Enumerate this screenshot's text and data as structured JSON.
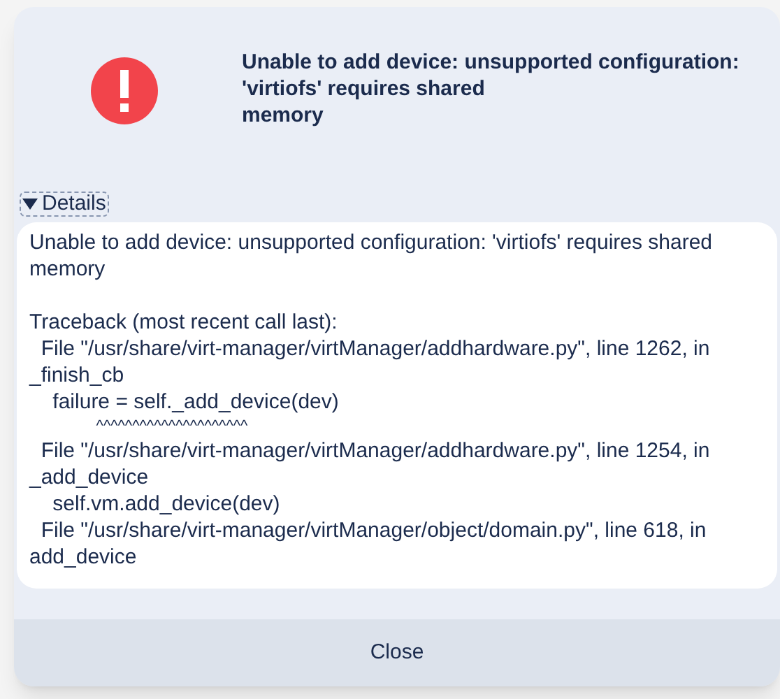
{
  "dialog": {
    "message_lines": [
      "Unable to add device: unsupported configuration:",
      "'virtiofs' requires shared",
      "memory"
    ],
    "details": {
      "label": "Details",
      "expanded": true,
      "text": [
        "Unable to add device: unsupported configuration: 'virtiofs' requires shared memory"
      ],
      "traceback": [
        {
          "kind": "text",
          "text": "Traceback (most recent call last):"
        },
        {
          "kind": "text",
          "text": "  File \"/usr/share/virt-manager/virtManager/addhardware.py\", line 1262, in _finish_cb"
        },
        {
          "kind": "text",
          "text": "    failure = self._add_device(dev)"
        },
        {
          "kind": "marker",
          "text": "              ^^^^^^^^^^^^^^^^^^^^^"
        },
        {
          "kind": "text",
          "text": "  File \"/usr/share/virt-manager/virtManager/addhardware.py\", line 1254, in _add_device"
        },
        {
          "kind": "text",
          "text": "    self.vm.add_device(dev)"
        },
        {
          "kind": "text",
          "text": "  File \"/usr/share/virt-manager/virtManager/object/domain.py\", line 618, in add_device"
        }
      ]
    },
    "buttons": [
      "Close"
    ]
  }
}
